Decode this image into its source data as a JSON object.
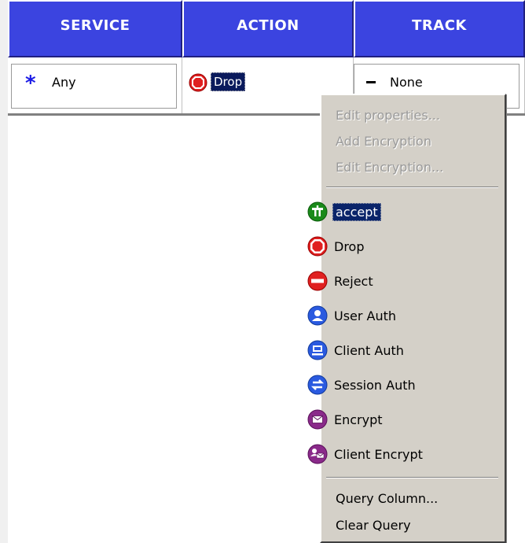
{
  "table": {
    "headers": {
      "service": "SERVICE",
      "action": "ACTION",
      "track": "TRACK"
    },
    "row": {
      "service": "Any",
      "action": "Drop",
      "track": "None"
    }
  },
  "menu": {
    "top_items": [
      {
        "label": "Edit properties...",
        "enabled": false
      },
      {
        "label": "Add Encryption",
        "enabled": false
      },
      {
        "label": "Edit Encryption...",
        "enabled": false
      }
    ],
    "actions": [
      {
        "label": "accept",
        "icon": "accept-icon",
        "color": "#1a8a1a",
        "selected": true
      },
      {
        "label": "Drop",
        "icon": "drop-icon",
        "color": "#e02020"
      },
      {
        "label": "Reject",
        "icon": "reject-icon",
        "color": "#e02020"
      },
      {
        "label": "User Auth",
        "icon": "user-auth-icon",
        "color": "#2a5ae0"
      },
      {
        "label": "Client Auth",
        "icon": "client-auth-icon",
        "color": "#2a5ae0"
      },
      {
        "label": "Session Auth",
        "icon": "session-auth-icon",
        "color": "#2a5ae0"
      },
      {
        "label": "Encrypt",
        "icon": "encrypt-icon",
        "color": "#8a2a8a"
      },
      {
        "label": "Client Encrypt",
        "icon": "client-encrypt-icon",
        "color": "#8a2a8a"
      }
    ],
    "bottom_items": [
      {
        "label": "Query Column..."
      },
      {
        "label": "Clear Query"
      }
    ]
  }
}
